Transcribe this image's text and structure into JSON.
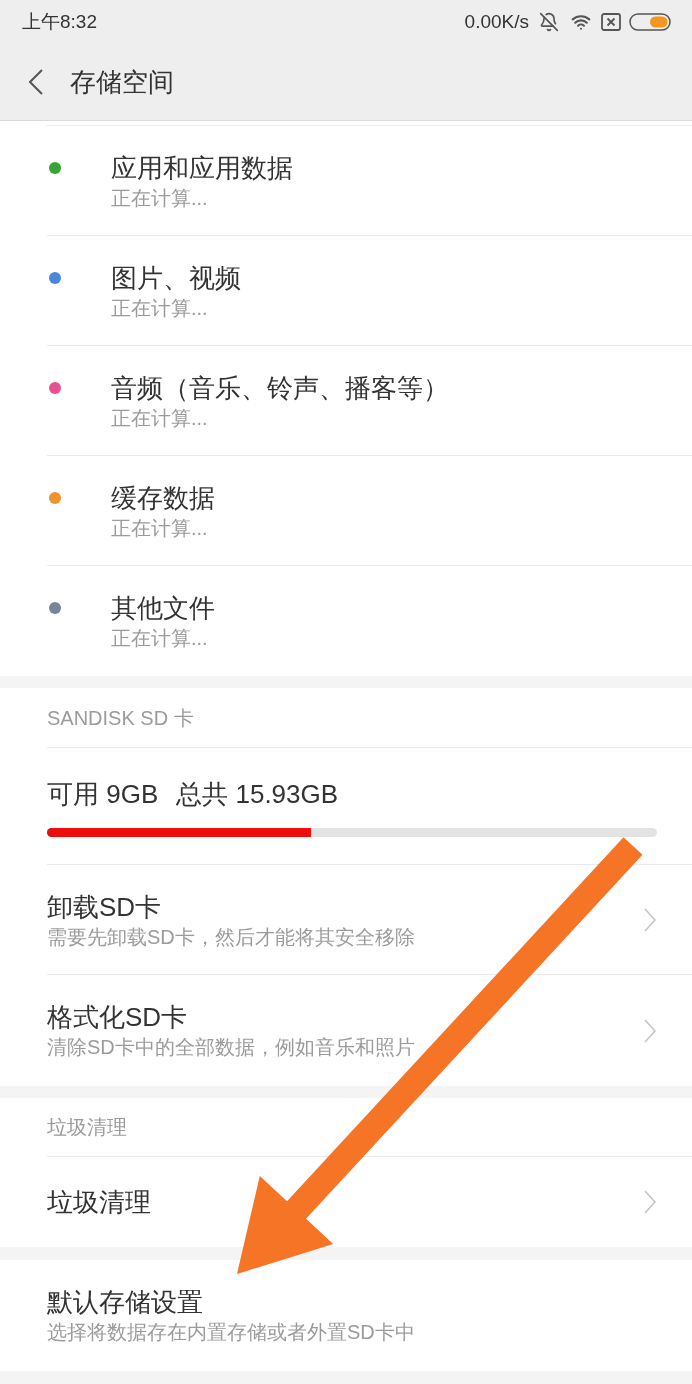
{
  "status_bar": {
    "time": "上午8:32",
    "network_speed": "0.00K/s"
  },
  "header": {
    "title": "存储空间"
  },
  "categories": [
    {
      "name": "应用和应用数据",
      "status": "正在计算...",
      "color": "#3aa335"
    },
    {
      "name": "图片、视频",
      "status": "正在计算...",
      "color": "#4a86dc"
    },
    {
      "name": "音频（音乐、铃声、播客等）",
      "status": "正在计算...",
      "color": "#e8508f"
    },
    {
      "name": "缓存数据",
      "status": "正在计算...",
      "color": "#f0922e"
    },
    {
      "name": "其他文件",
      "status": "正在计算...",
      "color": "#76859a"
    }
  ],
  "sd_card": {
    "heading": "SANDISK SD 卡",
    "available": "可用 9GB",
    "total": "总共 15.93GB",
    "level": 0.433,
    "items": [
      {
        "title": "卸载SD卡",
        "subtitle": "需要先卸载SD卡，然后才能将其安全移除"
      },
      {
        "title": "格式化SD卡",
        "subtitle": "清除SD卡中的全部数据，例如音乐和照片"
      }
    ]
  },
  "cleanup": {
    "heading": "垃圾清理",
    "items": [
      {
        "title": "垃圾清理"
      }
    ]
  },
  "default_storage": {
    "title": "默认存储设置",
    "subtitle": "选择将数据存在内置存储或者外置SD卡中"
  }
}
